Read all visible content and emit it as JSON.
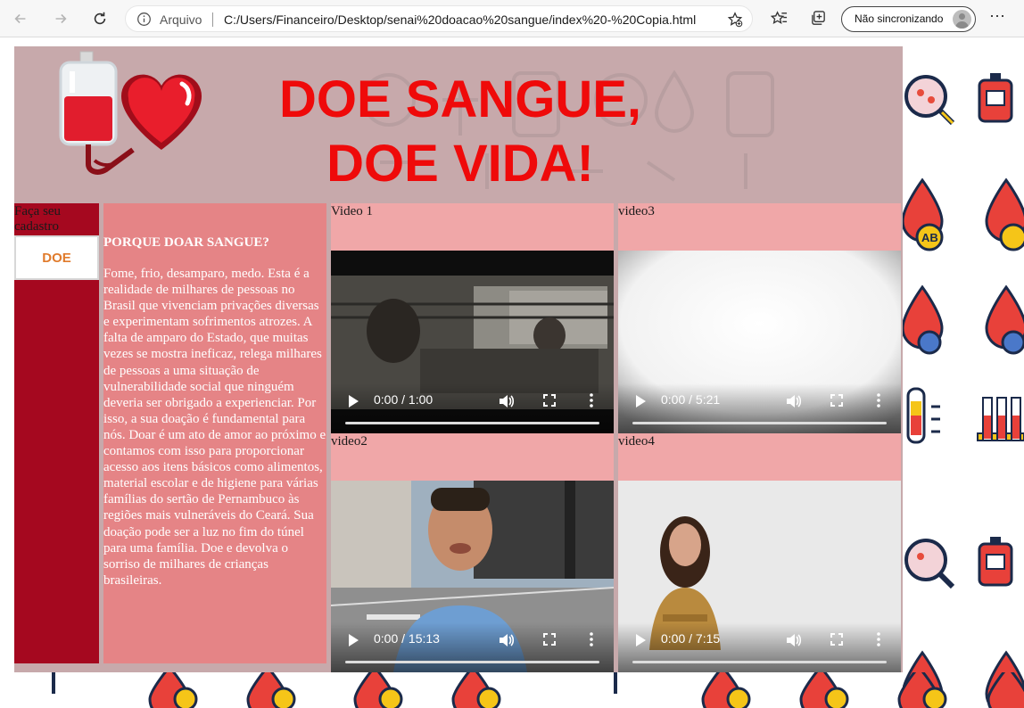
{
  "browser": {
    "address_label": "Arquivo",
    "url": "C:/Users/Financeiro/Desktop/senai%20doacao%20sangue/index%20-%20Copia.html",
    "sync_label": "Não sincronizando"
  },
  "header": {
    "title_line1": "DOE SANGUE,",
    "title_line2": "DOE VIDA!"
  },
  "sidebar": {
    "label": "Faça seu cadastro",
    "button": "DOE"
  },
  "article": {
    "heading": "PORQUE DOAR SANGUE?",
    "body": "Fome, frio, desamparo, medo. Esta é a realidade de milhares de pessoas no Brasil que vivenciam privações diversas e experimentam sofrimentos atrozes. A falta de amparo do Estado, que muitas vezes se mostra ineficaz, relega milhares de pessoas a uma situação de vulnerabilidade social que ninguém deveria ser obrigado a experienciar. Por isso, a sua doação é fundamental para nós. Doar é um ato de amor ao próximo e contamos com isso para proporcionar acesso aos itens básicos como alimentos, material escolar e de higiene para várias famílias do sertão de Pernambuco às regiões mais vulneráveis do Ceará. Sua doação pode ser a luz no fim do túnel para uma família. Doe e devolva o sorriso de milhares de crianças brasileiras."
  },
  "videos": [
    {
      "label": "Video 1",
      "time": "0:00 / 1:00"
    },
    {
      "label": "video3",
      "time": "0:00 / 5:21"
    },
    {
      "label": "video2",
      "time": "0:00 / 15:13"
    },
    {
      "label": "video4",
      "time": "0:00 / 7:15"
    }
  ],
  "colors": {
    "header_bg": "#c7a9ab",
    "title_red": "#ef0a0a",
    "sidebar_red": "#a5081f",
    "article_bg": "#e58486",
    "video_cell_bg": "#f0a7a8",
    "doe_text": "#e07b2c"
  }
}
